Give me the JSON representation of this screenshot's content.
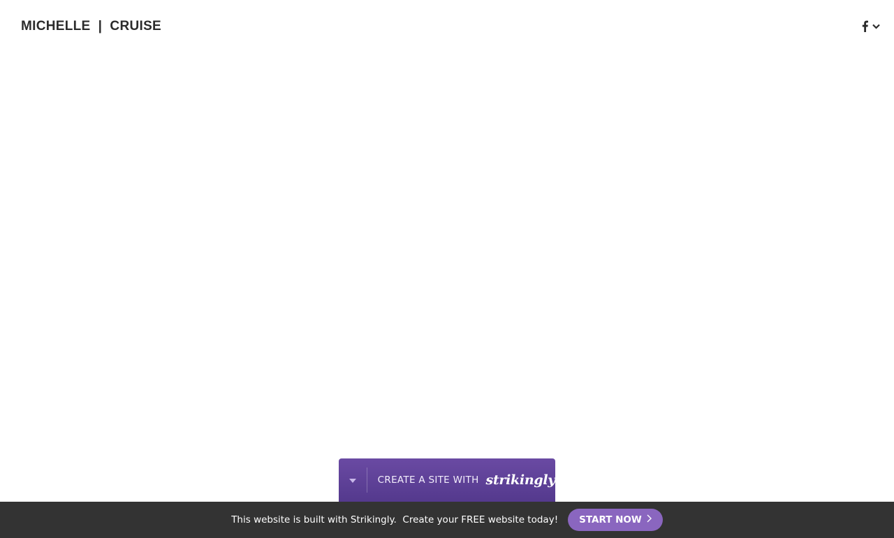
{
  "header": {
    "site_title": "MICHELLE  |  CRUISE",
    "social_icon": "facebook-icon",
    "dropdown_icon": "chevron-down-icon"
  },
  "badge": {
    "toggle_icon": "caret-down-icon",
    "text": "CREATE A SITE WITH",
    "logo_text": "strikingly"
  },
  "footer": {
    "text": "This website is built with Strikingly.  Create your FREE website today!",
    "button_label": "START NOW",
    "button_icon": "chevron-right-icon"
  },
  "colors": {
    "badge_purple": "#5c3f95",
    "button_purple": "#8a66bf",
    "footer_bg": "#333333",
    "title_text": "#2b2b2b"
  }
}
